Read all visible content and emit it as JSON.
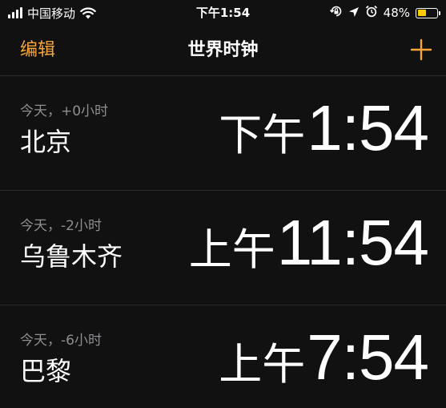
{
  "status_bar": {
    "carrier": "中国移动",
    "time": "下午1:54",
    "battery_percent": "48%",
    "battery_level": 0.48,
    "icons": [
      "signal-icon",
      "wifi-icon",
      "orientation-lock-icon",
      "location-icon",
      "alarm-icon",
      "battery-icon"
    ]
  },
  "nav": {
    "edit_label": "编辑",
    "title": "世界时钟",
    "add_icon": "plus-icon"
  },
  "clocks": [
    {
      "offset": "今天，+0小时",
      "city": "北京",
      "ampm": "下午",
      "time": "1:54"
    },
    {
      "offset": "今天，-2小时",
      "city": "乌鲁木齐",
      "ampm": "上午",
      "time": "11:54"
    },
    {
      "offset": "今天，-6小时",
      "city": "巴黎",
      "ampm": "上午",
      "time": "7:54"
    }
  ],
  "colors": {
    "accent": "#f7a43a",
    "background": "#111111",
    "secondary_text": "#8e8e93",
    "battery_fill": "#ffcc00"
  }
}
